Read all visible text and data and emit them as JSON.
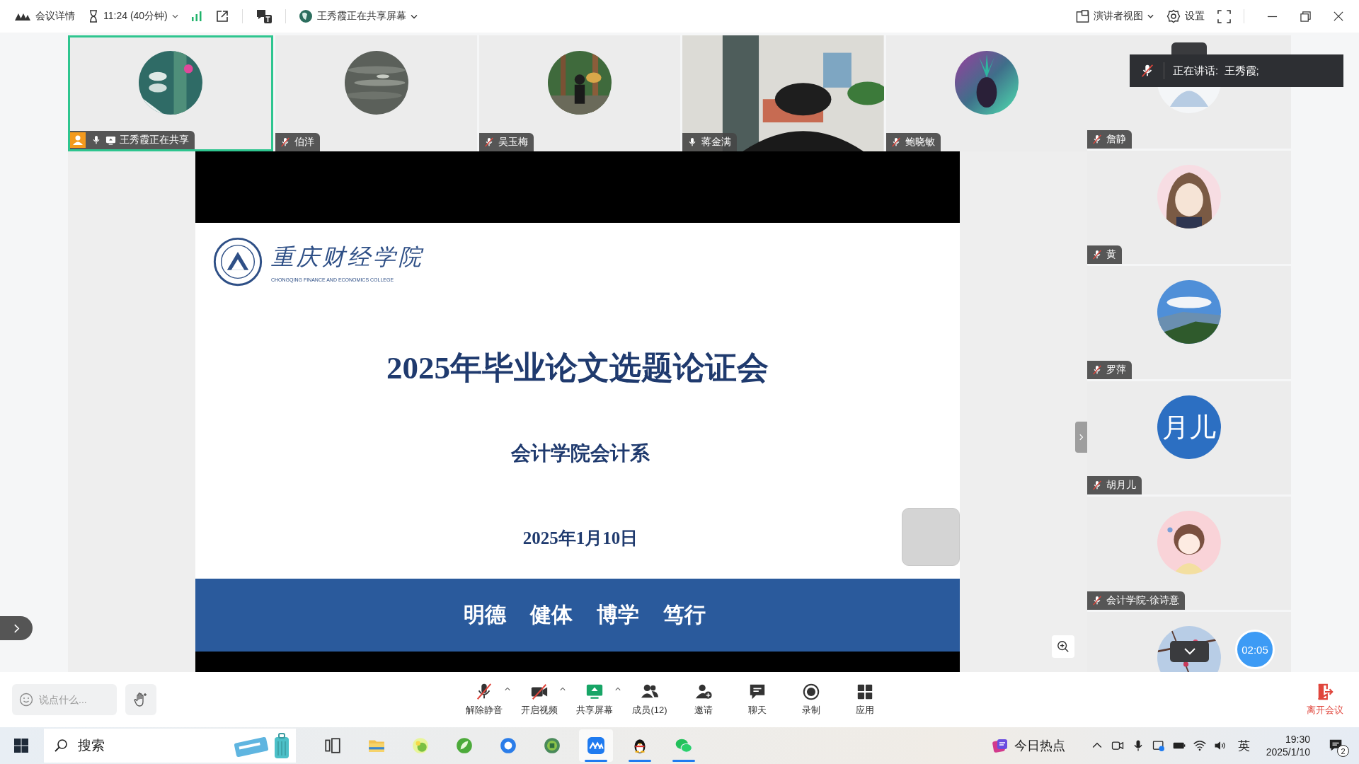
{
  "top_bar": {
    "meeting_details": "会议详情",
    "duration": "11:24 (40分钟)",
    "sharing_status": "王秀霞正在共享屏幕",
    "view_mode": "演讲者视图",
    "settings": "设置"
  },
  "participants": [
    {
      "name": "王秀霞正在共享",
      "kind": "picture",
      "muted": false,
      "host": true,
      "sharing": true,
      "selected": true
    },
    {
      "name": "伯洋",
      "kind": "picture",
      "muted": true,
      "host": false,
      "sharing": false,
      "selected": false
    },
    {
      "name": "吴玉梅",
      "kind": "picture",
      "muted": true,
      "host": false,
      "sharing": false,
      "selected": false
    },
    {
      "name": "蒋金满",
      "kind": "video",
      "muted": false,
      "host": false,
      "sharing": false,
      "selected": false
    },
    {
      "name": "鲍晓敏",
      "kind": "picture",
      "muted": true,
      "host": false,
      "sharing": false,
      "selected": false
    }
  ],
  "side_participants": [
    {
      "name": "詹静",
      "kind": "picture",
      "muted": true
    },
    {
      "name": "黄",
      "kind": "picture",
      "muted": true
    },
    {
      "name": "罗萍",
      "kind": "picture",
      "muted": true
    },
    {
      "name": "胡月儿",
      "kind": "initials",
      "initials": "月儿",
      "muted": true
    },
    {
      "name": "会计学院-徐诗意",
      "kind": "picture",
      "muted": true
    },
    {
      "kind": "picture"
    }
  ],
  "speaking_toast": {
    "text": "正在讲话:  王秀霞;",
    "muted": true
  },
  "slide": {
    "school_name": "重庆财经学院",
    "school_name_en": "CHONGQING FINANCE AND ECONOMICS COLLEGE",
    "title": "2025年毕业论文选题论证会",
    "department": "会计学院会计系",
    "date": "2025年1月10日",
    "motto": [
      "明德",
      "健体",
      "博学",
      "笃行"
    ]
  },
  "timer": "02:05",
  "toolbar": {
    "chat_placeholder": "说点什么...",
    "buttons": [
      {
        "label": "解除静音",
        "kind": "mic",
        "has_menu": true
      },
      {
        "label": "开启视频",
        "kind": "video",
        "has_menu": true
      },
      {
        "label": "共享屏幕",
        "kind": "share",
        "has_menu": true
      },
      {
        "label": "成员(12)",
        "kind": "members",
        "has_menu": false
      },
      {
        "label": "邀请",
        "kind": "invite",
        "has_menu": false
      },
      {
        "label": "聊天",
        "kind": "chat",
        "has_menu": false
      },
      {
        "label": "录制",
        "kind": "record",
        "has_menu": false
      },
      {
        "label": "应用",
        "kind": "apps",
        "has_menu": false
      }
    ],
    "leave": "离开会议"
  },
  "taskbar": {
    "search": "搜索",
    "apps": [
      {
        "kind": "taskview",
        "running": false,
        "active": false
      },
      {
        "kind": "folder",
        "running": false,
        "active": false
      },
      {
        "kind": "greenball",
        "running": false,
        "active": false
      },
      {
        "kind": "leaf",
        "running": false,
        "active": false
      },
      {
        "kind": "bluering",
        "running": false,
        "active": false
      },
      {
        "kind": "greenring",
        "running": false,
        "active": false
      },
      {
        "kind": "meeting",
        "running": true,
        "active": true
      },
      {
        "kind": "penguin",
        "running": true,
        "active": false
      },
      {
        "kind": "bubbles",
        "running": true,
        "active": false
      }
    ],
    "news": "今日热点",
    "ime": "英",
    "time": "19:30",
    "date": "2025/1/10",
    "notifications": "2"
  }
}
